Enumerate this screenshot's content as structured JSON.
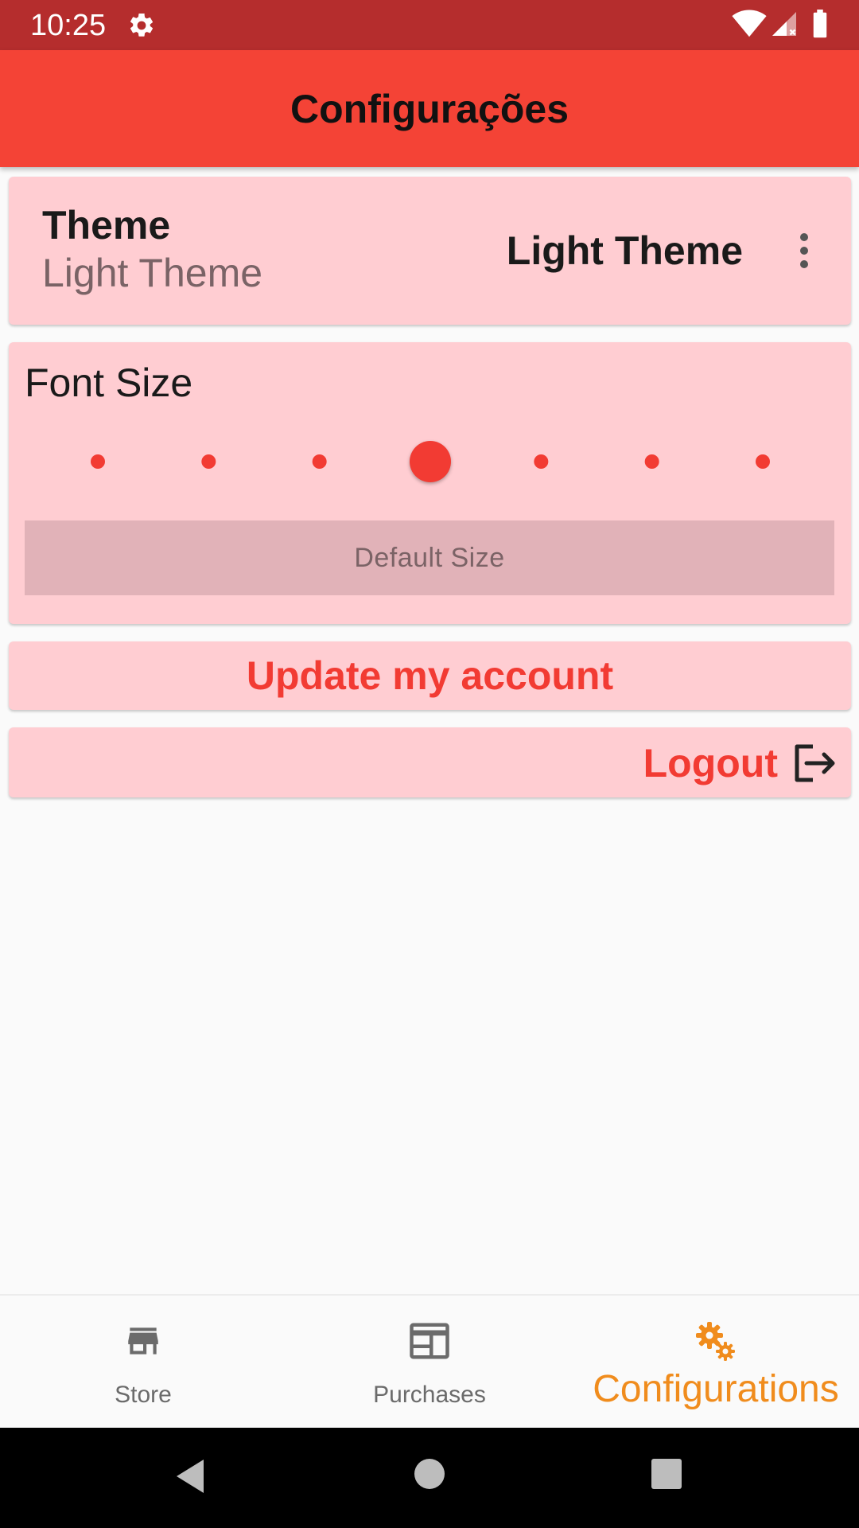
{
  "status_bar": {
    "time": "10:25"
  },
  "app_bar": {
    "title": "Configurações"
  },
  "theme_card": {
    "label": "Theme",
    "subtitle": "Light Theme",
    "selected_value": "Light Theme"
  },
  "font_size_card": {
    "label": "Font Size",
    "slider": {
      "steps": 7,
      "selected_index": 3
    },
    "reset_button_label": "Default Size"
  },
  "update_account": {
    "label": "Update my account"
  },
  "logout": {
    "label": "Logout"
  },
  "bottom_nav": {
    "items": [
      {
        "label": "Store",
        "icon": "store-icon",
        "active": false
      },
      {
        "label": "Purchases",
        "icon": "purchases-icon",
        "active": false
      },
      {
        "label": "Configurations",
        "icon": "settings-gears-icon",
        "active": true
      }
    ]
  },
  "colors": {
    "status_bar": "#b52d2d",
    "app_bar": "#f44336",
    "card_background": "#ffcdd2",
    "accent_red": "#f23b33",
    "active_nav": "#f08c1d",
    "inactive_nav": "#6b6b6b"
  }
}
